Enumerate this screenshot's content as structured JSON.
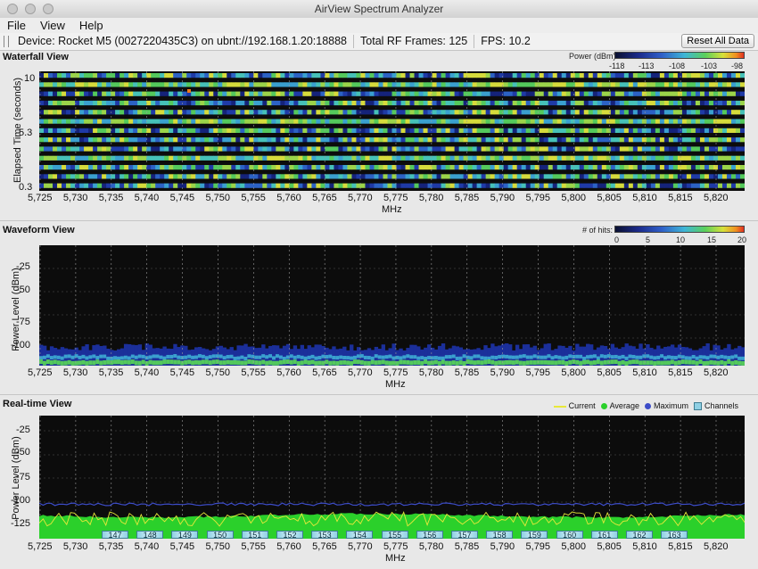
{
  "window": {
    "title": "AirView Spectrum Analyzer"
  },
  "menu": [
    "File",
    "View",
    "Help"
  ],
  "status": {
    "device": "Device: Rocket M5 (0027220435C3) on ubnt://192.168.1.20:18888",
    "frames": "Total RF Frames: 125",
    "fps": "FPS: 10.2",
    "reset_label": "Reset All Data"
  },
  "x_axis": {
    "label": "MHz",
    "ticks": [
      "5,725",
      "5,730",
      "5,735",
      "5,740",
      "5,745",
      "5,750",
      "5,755",
      "5,760",
      "5,765",
      "5,770",
      "5,775",
      "5,780",
      "5,785",
      "5,790",
      "5,795",
      "5,800",
      "5,805",
      "5,810",
      "5,815",
      "5,820"
    ]
  },
  "waterfall": {
    "title": "Waterfall View",
    "legend_label": "Power (dBm):",
    "legend_ticks": [
      "-118",
      "-113",
      "-108",
      "-103",
      "-98"
    ],
    "ylabel": "Elapsed Time (seconds)",
    "yticks": [
      "10",
      "5.3",
      "0.3"
    ]
  },
  "waveform": {
    "title": "Waveform View",
    "legend_label": "# of hits:",
    "legend_ticks": [
      "0",
      "5",
      "10",
      "15",
      "20"
    ],
    "ylabel": "Power Level (dBm)",
    "yticks": [
      "-25",
      "-50",
      "-75",
      "-100"
    ]
  },
  "realtime": {
    "title": "Real-time View",
    "legend": {
      "current": "Current",
      "average": "Average",
      "maximum": "Maximum",
      "channels": "Channels"
    },
    "ylabel": "Power Level (dBm)",
    "yticks": [
      "-25",
      "-50",
      "-75",
      "-100",
      "-125"
    ],
    "channels": [
      "147",
      "148",
      "149",
      "150",
      "151",
      "152",
      "153",
      "154",
      "155",
      "156",
      "157",
      "158",
      "159",
      "160",
      "161",
      "162",
      "163"
    ]
  },
  "colors": {
    "current": "#e8e83a",
    "average": "#2bd02b",
    "maximum": "#3c4cc8",
    "channels": "#8fd0e4",
    "plot_bg": "#0c0c0c"
  }
}
